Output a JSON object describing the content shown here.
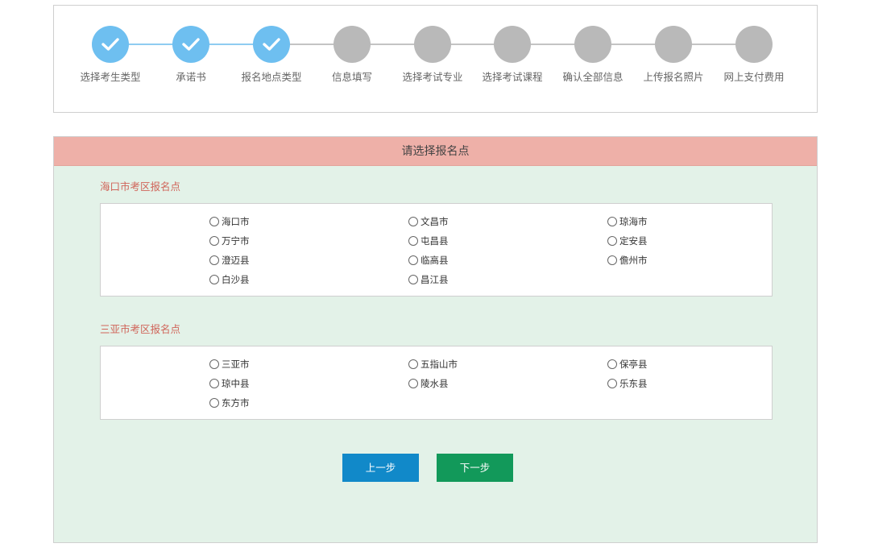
{
  "stepper": {
    "steps": [
      {
        "label": "选择考生类型",
        "done": true
      },
      {
        "label": "承诺书",
        "done": true
      },
      {
        "label": "报名地点类型",
        "done": true
      },
      {
        "label": "信息填写",
        "done": false
      },
      {
        "label": "选择考试专业",
        "done": false
      },
      {
        "label": "选择考试课程",
        "done": false
      },
      {
        "label": "确认全部信息",
        "done": false
      },
      {
        "label": "上传报名照片",
        "done": false
      },
      {
        "label": "网上支付费用",
        "done": false
      }
    ],
    "done_color": "#6ebff0",
    "pending_color": "#b9b9b9"
  },
  "main": {
    "header": "请选择报名点",
    "sections": [
      {
        "title": "海口市考区报名点",
        "options": [
          "海口市",
          "文昌市",
          "琼海市",
          "万宁市",
          "屯昌县",
          "定安县",
          "澄迈县",
          "临高县",
          "儋州市",
          "白沙县",
          "昌江县"
        ]
      },
      {
        "title": "三亚市考区报名点",
        "options": [
          "三亚市",
          "五指山市",
          "保亭县",
          "琼中县",
          "陵水县",
          "乐东县",
          "东方市"
        ]
      }
    ],
    "buttons": {
      "prev": "上一步",
      "next": "下一步"
    }
  },
  "colors": {
    "header_bg": "#eeb0a8",
    "panel_bg": "#e3f2e8",
    "section_title": "#d0655a",
    "prev_button": "#1189c9",
    "next_button": "#12995a"
  }
}
